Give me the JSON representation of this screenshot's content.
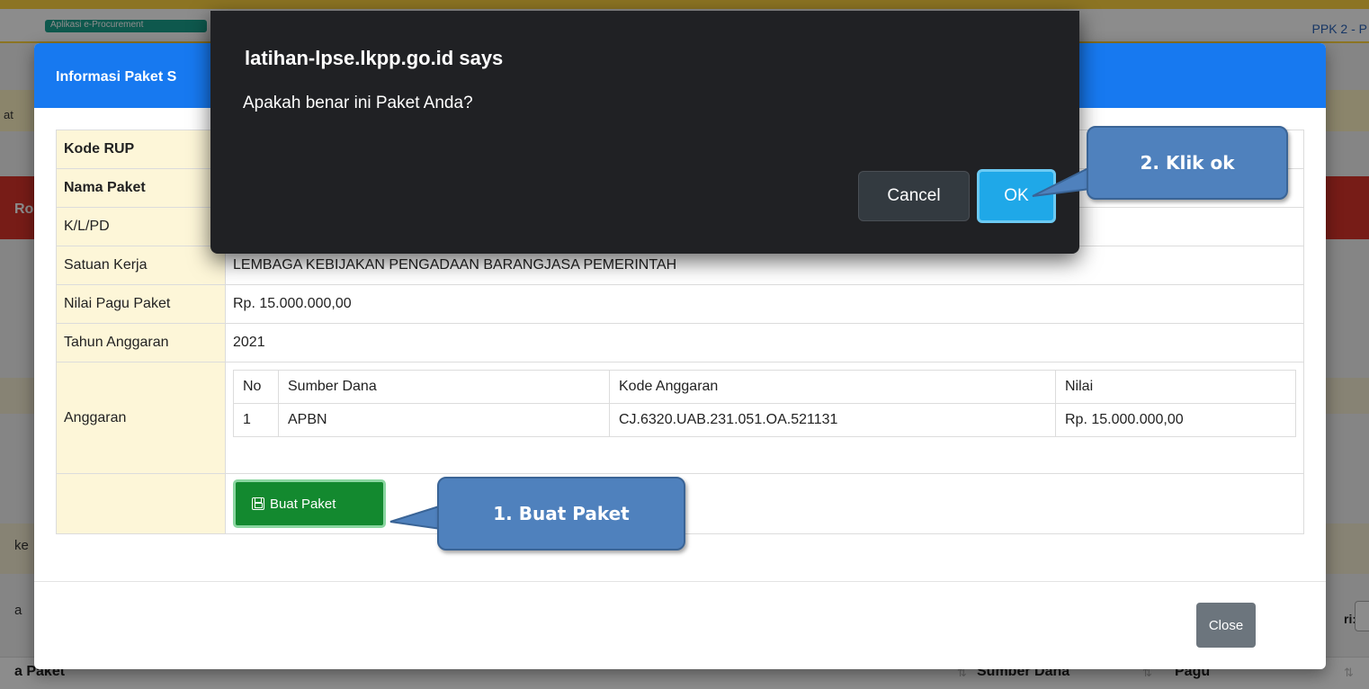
{
  "background": {
    "chip_text": "Aplikasi e-Procurement",
    "user_link": "PPK 2 - P",
    "edge_texts": [
      "at",
      "Ro",
      "ke",
      "a"
    ],
    "search_label": "ri:",
    "columns": [
      "a Paket",
      "Sumber Dana",
      "Pagu"
    ],
    "sort_icon": "⇅"
  },
  "modal": {
    "title": "Informasi Paket S",
    "rows": [
      {
        "label": "Kode RUP",
        "value": ""
      },
      {
        "label": "Nama Paket",
        "value": ""
      },
      {
        "label": "K/L/PD",
        "value": ""
      },
      {
        "label": "Satuan Kerja",
        "value": "LEMBAGA KEBIJAKAN PENGADAAN BARANGJASA PEMERINTAH"
      },
      {
        "label": "Nilai Pagu Paket",
        "value": "Rp. 15.000.000,00"
      },
      {
        "label": "Tahun Anggaran",
        "value": "2021"
      },
      {
        "label": "Anggaran",
        "value": ""
      }
    ],
    "anggaran_table": {
      "headers": [
        "No",
        "Sumber Dana",
        "Kode Anggaran",
        "Nilai"
      ],
      "rows": [
        [
          "1",
          "APBN",
          "CJ.6320.UAB.231.051.OA.521131",
          "Rp. 15.000.000,00"
        ]
      ]
    },
    "buat_paket_label": "Buat Paket",
    "buat_paket_icon": "save-icon",
    "close_label": "Close"
  },
  "confirm_dialog": {
    "title": "latihan-lpse.lkpp.go.id says",
    "message": "Apakah benar ini Paket Anda?",
    "cancel_label": "Cancel",
    "ok_label": "OK"
  },
  "callouts": {
    "step1": "1.   Buat Paket",
    "step2": "2.   Klik ok"
  },
  "colors": {
    "modal_header": "#1779f0",
    "buat_button": "#13892f",
    "ok_button": "#1fa8e8",
    "callout": "#4f81bd",
    "dialog_bg": "#202124"
  }
}
